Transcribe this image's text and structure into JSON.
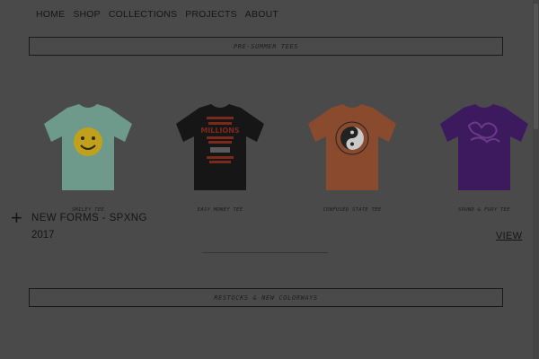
{
  "nav": {
    "items": [
      {
        "label": "HOME"
      },
      {
        "label": "SHOP"
      },
      {
        "label": "COLLECTIONS"
      },
      {
        "label": "PROJECTS"
      },
      {
        "label": "ABOUT"
      }
    ]
  },
  "banners": {
    "top": "PRE-SUMMER TEES",
    "bottom": "RESTOCKS & NEW COLORWAYS"
  },
  "products": [
    {
      "name": "SMILEY TEE",
      "color": "#6d9a8a",
      "graphic": "smiley-face"
    },
    {
      "name": "EASY MONEY TEE",
      "color": "#161616",
      "graphic": "millions-text",
      "graphic_text": "MILLIONS"
    },
    {
      "name": "CONFUSED STATE TEE",
      "color": "#8a4a2e",
      "graphic": "yin-yang"
    },
    {
      "name": "SOUND & FURY TEE",
      "color": "#3d1a5e",
      "graphic": "script-text"
    }
  ],
  "collection": {
    "title": "NEW FORMS - SPXNG",
    "year": "2017",
    "view_label": "VIEW",
    "expand_icon": "plus-icon"
  },
  "colors": {
    "overlay_bg": "#4a4a4a",
    "text": "#1a1a1a"
  }
}
